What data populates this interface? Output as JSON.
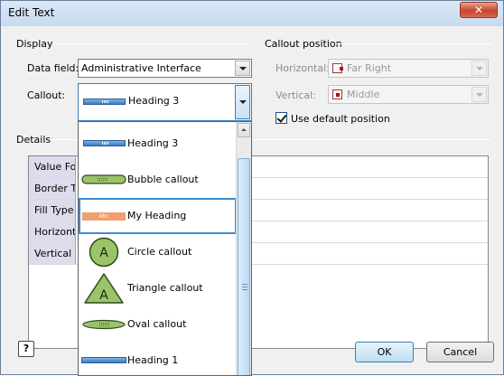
{
  "window": {
    "title": "Edit Text",
    "close_label": "✕"
  },
  "display": {
    "title": "Display",
    "data_field_label": "Data field:",
    "data_field_value": "Administrative Interface",
    "callout_label": "Callout:",
    "callout_value": "Heading 3"
  },
  "callout_position": {
    "title": "Callout position",
    "horizontal_label": "Horizontal:",
    "horizontal_value": "Far Right",
    "vertical_label": "Vertical:",
    "vertical_value": "Middle",
    "use_default_label": "Use default position",
    "use_default_checked": true
  },
  "details": {
    "title": "Details",
    "rows": [
      "Value For",
      "Border Ty",
      "Fill Type",
      "Horizonta",
      "Vertical C"
    ]
  },
  "dropdown": {
    "items": [
      {
        "label": "Heading 3",
        "icon": "heading-3-bar"
      },
      {
        "label": "Bubble callout",
        "icon": "bubble-callout-shape"
      },
      {
        "label": "My Heading",
        "icon": "my-heading-bar",
        "icon_text": "Abc",
        "selected": true
      },
      {
        "label": "Circle callout",
        "icon": "circle-callout-shape",
        "icon_text": "A"
      },
      {
        "label": "Triangle callout",
        "icon": "triangle-callout-shape",
        "icon_text": "A"
      },
      {
        "label": "Oval callout",
        "icon": "oval-callout-shape"
      },
      {
        "label": "Heading 1",
        "icon": "heading-1-bar"
      }
    ]
  },
  "buttons": {
    "help": "?",
    "ok": "OK",
    "cancel": "Cancel"
  },
  "colors": {
    "accent": "#3c7bc4",
    "callout_green": "#9bc46a",
    "heading_orange": "#f0a070"
  }
}
